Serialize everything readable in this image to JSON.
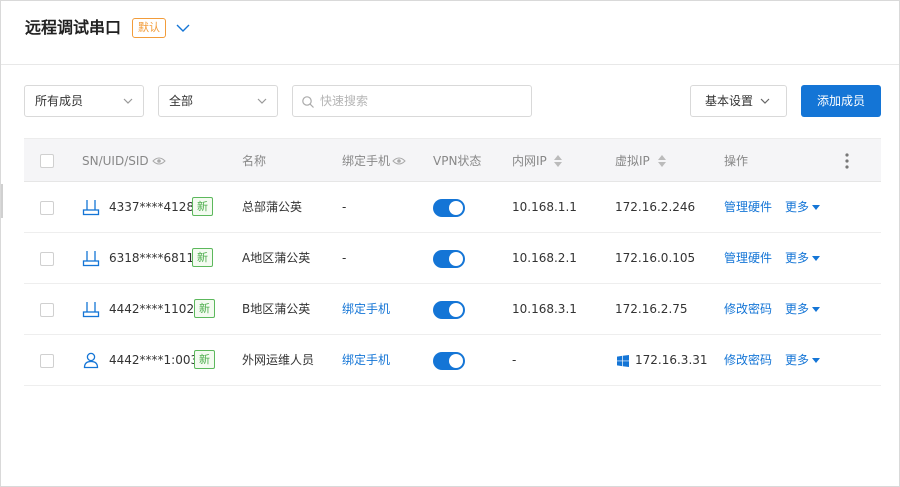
{
  "header": {
    "title": "远程调试串口",
    "badge": "默认"
  },
  "toolbar": {
    "member_filter": "所有成员",
    "status_filter": "全部",
    "search_placeholder": "快速搜索",
    "settings_label": "基本设置",
    "add_member_label": "添加成员"
  },
  "table": {
    "columns": [
      "SN/UID/SID",
      "名称",
      "绑定手机",
      "VPN状态",
      "内网IP",
      "虚拟IP",
      "操作"
    ],
    "rows": [
      {
        "sn": "4337****4128",
        "new_tag": "新",
        "name": "总部蒲公英",
        "phone": "-",
        "vpn_on": true,
        "lan_ip": "10.168.1.1",
        "virtual_ip": "172.16.2.246",
        "action": "管理硬件",
        "more": "更多"
      },
      {
        "sn": "6318****6811",
        "new_tag": "新",
        "name": "A地区蒲公英",
        "phone": "-",
        "vpn_on": true,
        "lan_ip": "10.168.2.1",
        "virtual_ip": "172.16.0.105",
        "action": "管理硬件",
        "more": "更多"
      },
      {
        "sn": "4442****1102",
        "new_tag": "新",
        "name": "B地区蒲公英",
        "phone": "绑定手机",
        "vpn_on": true,
        "lan_ip": "10.168.3.1",
        "virtual_ip": "172.16.2.75",
        "action": "修改密码",
        "more": "更多"
      },
      {
        "sn": "4442****1:003",
        "new_tag": "新",
        "name": "外网运维人员",
        "phone": "绑定手机",
        "vpn_on": true,
        "lan_ip": "-",
        "virtual_ip": "172.16.3.31",
        "action": "修改密码",
        "more": "更多"
      }
    ]
  },
  "colors": {
    "accent": "#1475d6",
    "badge": "#f29c3a",
    "new_tag": "#5cb85c"
  }
}
